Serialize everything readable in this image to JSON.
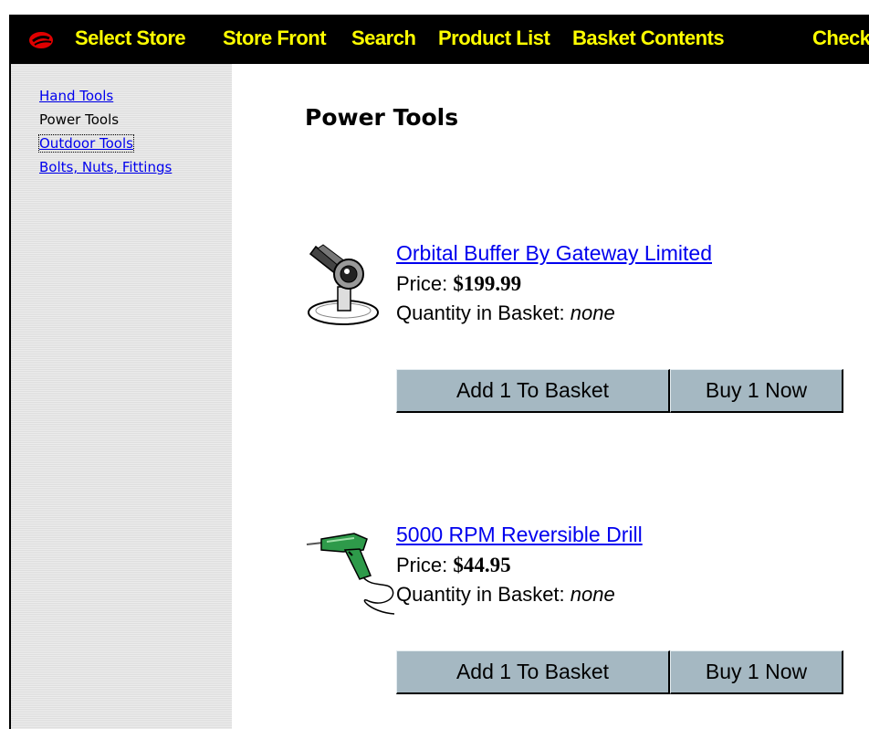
{
  "topnav": {
    "items": [
      {
        "label": "Select Store"
      },
      {
        "label": "Store Front"
      },
      {
        "label": "Search"
      },
      {
        "label": "Product List"
      },
      {
        "label": "Basket Contents"
      },
      {
        "label": "Checkout"
      }
    ]
  },
  "sidebar": {
    "items": [
      {
        "label": "Hand Tools",
        "state": "link"
      },
      {
        "label": "Power Tools",
        "state": "current"
      },
      {
        "label": "Outdoor Tools",
        "state": "focused-link"
      },
      {
        "label": "Bolts, Nuts, Fittings",
        "state": "link"
      }
    ]
  },
  "main": {
    "title": "Power Tools",
    "price_label": "Price:",
    "quantity_label": "Quantity in Basket:",
    "add_label": "Add 1 To Basket",
    "buy_label": "Buy 1 Now",
    "products": [
      {
        "name": "Orbital Buffer By Gateway Limited",
        "price": "$199.99",
        "quantity": "none",
        "icon": "orbital-buffer-icon"
      },
      {
        "name": "5000 RPM Reversible Drill",
        "price": "$44.95",
        "quantity": "none",
        "icon": "power-drill-icon"
      }
    ]
  },
  "colors": {
    "nav_background": "#000000",
    "nav_text": "#ffff00",
    "logo": "#e00000",
    "link": "#0000ee",
    "button": "#a5b8c2",
    "drill_body": "#2e9a4a"
  }
}
